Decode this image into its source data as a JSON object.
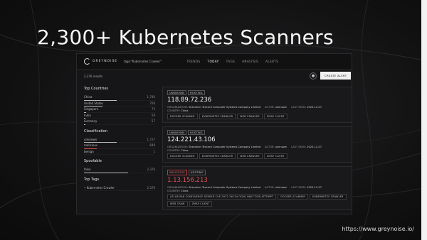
{
  "slide": {
    "title": "2,300+ Kubernetes Scanners",
    "url": "https://www.greynoise.io/"
  },
  "app": {
    "logo": "GREYNOISE",
    "search_query": "tags:\"Kubernetes Crawler\"",
    "nav": [
      "TRENDS",
      "TODAY",
      "TAGS",
      "ANALYSIS",
      "ALERTS"
    ],
    "nav_active": "TODAY",
    "results_label": "2,376 results",
    "create_alert_label": "CREATE ALERT",
    "bell_icon": "bell-icon"
  },
  "sidebar": {
    "countries": {
      "title": "Top Countries",
      "rows": [
        {
          "label": "China",
          "value": "1,740"
        },
        {
          "label": "United States",
          "value": "700"
        },
        {
          "label": "Singapore",
          "value": "75"
        },
        {
          "label": "India",
          "value": "59"
        },
        {
          "label": "Germany",
          "value": "57"
        }
      ]
    },
    "classification": {
      "title": "Classification",
      "rows": [
        {
          "label": "unknown",
          "value": "1,727"
        },
        {
          "label": "malicious",
          "value": "648"
        },
        {
          "label": "benign",
          "value": "1"
        }
      ]
    },
    "spoofable": {
      "title": "Spoofable",
      "rows": [
        {
          "label": "false",
          "value": "2,376"
        }
      ]
    },
    "top_tags": {
      "title": "Top Tags",
      "rows": [
        {
          "label": "Kubernetes Crawler",
          "value": "2,376"
        }
      ]
    }
  },
  "cards": [
    {
      "tags": [
        "UNKNOWN",
        "HOSTING"
      ],
      "ip": "118.89.72.236",
      "org_label": "ORGANIZATION:",
      "org": "Shenzhen Tencent Computer Systems Company Limited",
      "actor_label": "ACTOR:",
      "actor": "unknown",
      "last_seen_label": "LAST SEEN:",
      "last_seen": "2023-12-07",
      "country_label": "COUNTRY:",
      "country": "China",
      "chips": [
        "DOCKER SCANNER",
        "KUBERNETES CRAWLER",
        "WEB CRAWLER",
        "ZMAP CLIENT"
      ]
    },
    {
      "tags": [
        "UNKNOWN",
        "HOSTING"
      ],
      "ip": "124.221.43.106",
      "org_label": "ORGANIZATION:",
      "org": "Shenzhen Tencent Computer Systems Company Limited",
      "actor_label": "ACTOR:",
      "actor": "unknown",
      "last_seen_label": "LAST SEEN:",
      "last_seen": "2023-12-07",
      "country_label": "COUNTRY:",
      "country": "China",
      "chips": [
        "DOCKER SCANNER",
        "KUBERNETES CRAWLER",
        "WEB CRAWLER",
        "ZMAP CLIENT"
      ]
    },
    {
      "tags": [
        "MALICIOUS",
        "HOSTING"
      ],
      "ip": "1.13.156.213",
      "org_label": "ORGANIZATION:",
      "org": "Shenzhen Tencent Computer Systems Company Limited",
      "actor_label": "ACTOR:",
      "actor": "unknown",
      "last_seen_label": "LAST SEEN:",
      "last_seen": "2023-12-07",
      "country_label": "COUNTRY:",
      "country": "China",
      "chips": [
        "ATLASSIAN CONFLUENCE SERVER CVE-2022-26134 OGNL INJECTION ATTEMPT",
        "DOCKER SCANNER",
        "KUBERNETES CRAWLER",
        "WEB CRAW",
        "ZMAP CLIENT"
      ]
    }
  ],
  "colors": {
    "accent_malicious": "#e05454",
    "background": "#0e0e0f"
  }
}
